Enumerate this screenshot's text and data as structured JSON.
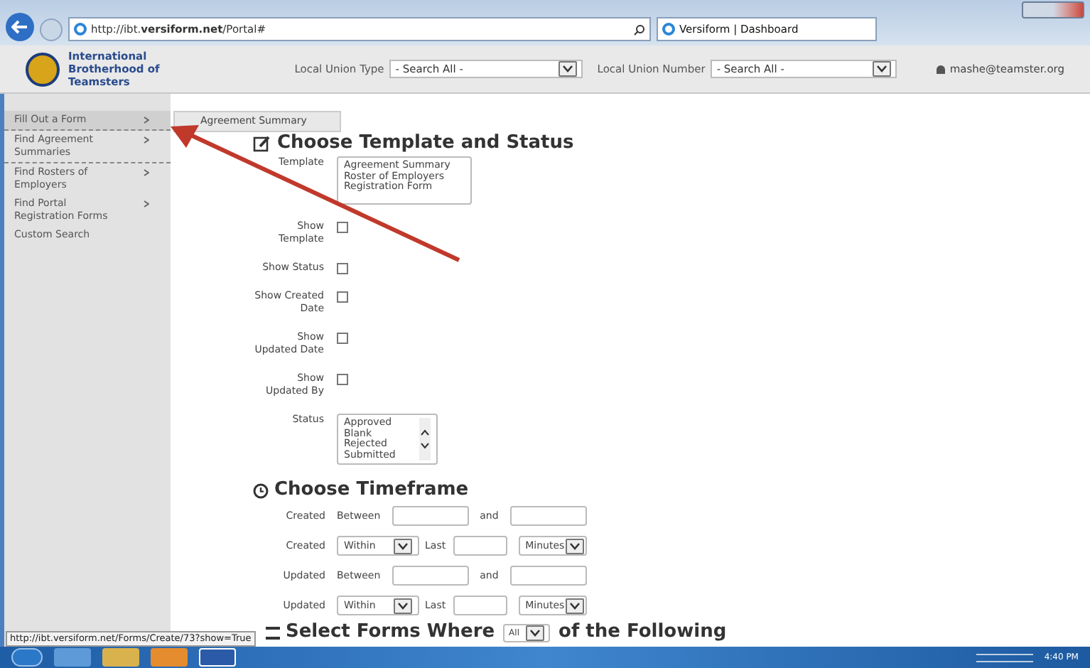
{
  "browser": {
    "address": "http://ibt.**versiform.net**/Portal#",
    "tab": "Versiform | Dashboard"
  },
  "header": {
    "org_name": "International Brotherhood of Teamsters",
    "filters": [
      {
        "label": "Local Union Type",
        "value": "- Search All -"
      },
      {
        "label": "Local Union Number",
        "value": "- Search All -"
      }
    ],
    "user": "mashe@teamster.org"
  },
  "sidebar": {
    "items": [
      {
        "label": "Fill Out a Form",
        "submenu": true,
        "selected": true
      },
      {
        "label": "Find Agreement Summaries",
        "submenu": true,
        "selected": false
      },
      {
        "label": "Find Rosters of Employers",
        "submenu": true,
        "selected": false
      },
      {
        "label": "Find Portal Registration Forms",
        "submenu": true,
        "selected": false
      },
      {
        "label": "Custom Search",
        "submenu": false,
        "selected": false
      }
    ]
  },
  "submenu": {
    "items": [
      "Agreement Summary"
    ]
  },
  "template_section": {
    "title": "Choose Template and Status",
    "fields": [
      {
        "kind": "listbox",
        "label": "Template",
        "options": [
          "Agreement Summary",
          "Roster of Employers",
          "Registration Form"
        ],
        "scroll": false
      },
      {
        "kind": "checkbox",
        "label": "Show Template",
        "checked": false
      },
      {
        "kind": "checkbox",
        "label": "Show Status",
        "checked": false
      },
      {
        "kind": "checkbox",
        "label": "Show Created Date",
        "checked": false
      },
      {
        "kind": "checkbox",
        "label": "Show Updated Date",
        "checked": false
      },
      {
        "kind": "checkbox",
        "label": "Show Updated By",
        "checked": false
      },
      {
        "kind": "listbox",
        "label": "Status",
        "options": [
          "Approved",
          "Blank",
          "Rejected",
          "Submitted"
        ],
        "scroll": true
      }
    ]
  },
  "timeframe_section": {
    "title": "Choose Timeframe",
    "rows": [
      {
        "kind": "between",
        "label": "Created",
        "mode": "Between",
        "joiner": "and"
      },
      {
        "kind": "within",
        "label": "Created",
        "mode": "Within",
        "joiner": "Last",
        "unit": "Minutes"
      },
      {
        "kind": "between",
        "label": "Updated",
        "mode": "Between",
        "joiner": "and"
      },
      {
        "kind": "within",
        "label": "Updated",
        "mode": "Within",
        "joiner": "Last",
        "unit": "Minutes"
      }
    ]
  },
  "select_section": {
    "title_before": "Select Forms Where",
    "choice": "All",
    "title_after": "of the Following"
  },
  "status_url": "http://ibt.versiform.net/Forms/Create/73?show=True",
  "taskbar": {
    "clock": "4:40 PM"
  }
}
